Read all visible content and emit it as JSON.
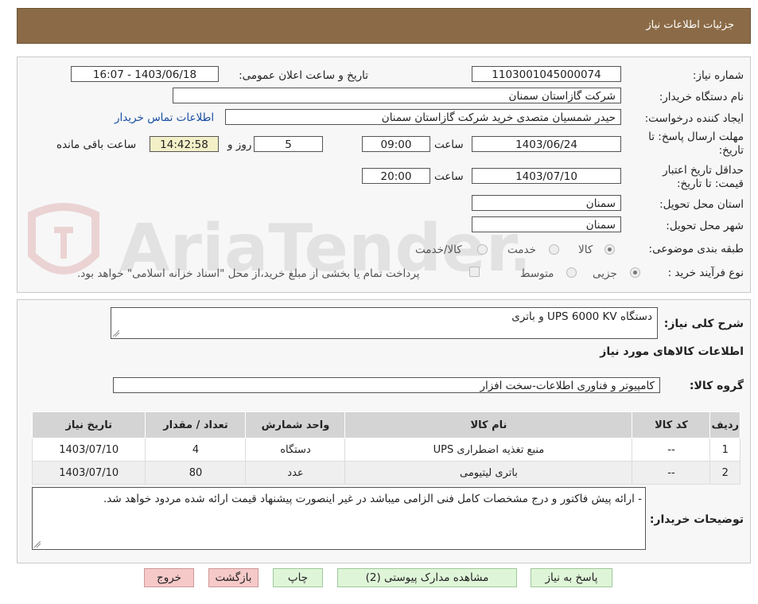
{
  "header": {
    "title": "جزئیات اطلاعات نیاز"
  },
  "form": {
    "need_number_label": "شماره نیاز:",
    "need_number": "1103001045000074",
    "announce_label": "تاریخ و ساعت اعلان عمومی:",
    "announce_value": "1403/06/18 - 16:07",
    "buyer_org_label": "نام دستگاه خریدار:",
    "buyer_org": "شرکت گازاستان سمنان",
    "requester_label": "ایجاد کننده درخواست:",
    "requester": "حیدر شمسیان متصدی خرید شرکت گازاستان سمنان",
    "contact_link": "اطلاعات تماس خریدار",
    "deadline_label_1": "مهلت ارسال پاسخ: تا",
    "deadline_label_2": "تاریخ:",
    "deadline_date": "1403/06/24",
    "time_label": "ساعت",
    "deadline_time": "09:00",
    "days_value": "5",
    "days_label": "روز و",
    "remaining_time": "14:42:58",
    "remaining_label": "ساعت باقی مانده",
    "validity_label_1": "حداقل تاریخ اعتبار",
    "validity_label_2": "قیمت: تا تاریخ:",
    "validity_date": "1403/07/10",
    "validity_time_label": "ساعت",
    "validity_time": "20:00",
    "province_label": "استان محل تحویل:",
    "province": "سمنان",
    "city_label": "شهر محل تحویل:",
    "city": "سمنان",
    "category_label": "طبقه بندی موضوعی:",
    "category_options": [
      "کالا",
      "خدمت",
      "کالا/خدمت"
    ],
    "process_label": "نوع فرآیند خرید :",
    "process_options": [
      "جزیی",
      "متوسط"
    ],
    "payment_note": "پرداخت تمام یا بخشی از مبلغ خرید،از محل \"اسناد خزانه اسلامی\" خواهد بود."
  },
  "summary": {
    "description_label": "شرح کلی نیاز:",
    "description": "دستگاه UPS 6000 KV و باتری",
    "goods_info_title": "اطلاعات کالاهای مورد نیاز",
    "goods_group_label": "گروه کالا:",
    "goods_group": "کامپیوتر و فناوری اطلاعات-سخت افزار"
  },
  "table": {
    "headers": [
      "ردیف",
      "کد کالا",
      "نام کالا",
      "واحد شمارش",
      "تعداد / مقدار",
      "تاریخ نیاز"
    ],
    "rows": [
      [
        "1",
        "--",
        "منبع تغذیه اضطراری UPS",
        "دستگاه",
        "4",
        "1403/07/10"
      ],
      [
        "2",
        "--",
        "باتری لیتیومی",
        "عدد",
        "80",
        "1403/07/10"
      ]
    ]
  },
  "notes": {
    "label": "توضیحات خریدار:",
    "text": "- ارائه پیش فاکتور و درج مشخصات کامل فنی الزامی میباشد در غیر اینصورت پیشنهاد قیمت ارائه شده مردود خواهد شد."
  },
  "buttons": {
    "reply": "پاسخ به نیاز",
    "attachments": "مشاهده مدارک پیوستی (2)",
    "print": "چاپ",
    "back": "بازگشت",
    "exit": "خروج"
  },
  "watermark": "AriaTender.neT",
  "colors": {
    "header_bg": "#8b6b47",
    "link": "#1a4fa3",
    "remaining_bg": "#f3f0c8",
    "button_green": "#dff5d8",
    "button_pink": "#f6c9c9"
  }
}
